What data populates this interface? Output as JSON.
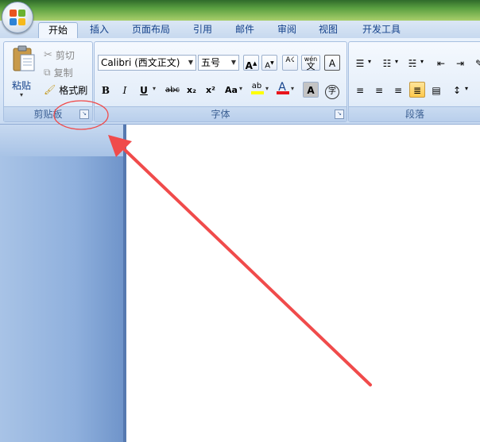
{
  "tabs": [
    {
      "label": "开始",
      "active": true
    },
    {
      "label": "插入"
    },
    {
      "label": "页面布局"
    },
    {
      "label": "引用"
    },
    {
      "label": "邮件"
    },
    {
      "label": "审阅"
    },
    {
      "label": "视图"
    },
    {
      "label": "开发工具"
    }
  ],
  "clipboard": {
    "paste_label": "粘贴",
    "cut_label": "剪切",
    "copy_label": "复制",
    "format_painter_label": "格式刷",
    "group_label": "剪贴板"
  },
  "font": {
    "font_name": "Calibri (西文正文)",
    "font_size": "五号",
    "group_label": "字体",
    "bold": "B",
    "italic": "I",
    "underline": "U",
    "strikethrough": "abc",
    "subscript": "x₂",
    "superscript": "x²",
    "change_case": "Aa",
    "grow": "A",
    "shrink": "A",
    "phonetic": "wén",
    "phonetic_char": "文",
    "border_char": "A",
    "font_color": "A",
    "shading_char": "A",
    "enclose_char": "字",
    "highlight": "ab"
  },
  "paragraph": {
    "group_label": "段落"
  },
  "colors": {
    "font_color_bar": "#e8141b",
    "highlight_bar": "#ffff00",
    "annotation": "#f04b4b"
  }
}
